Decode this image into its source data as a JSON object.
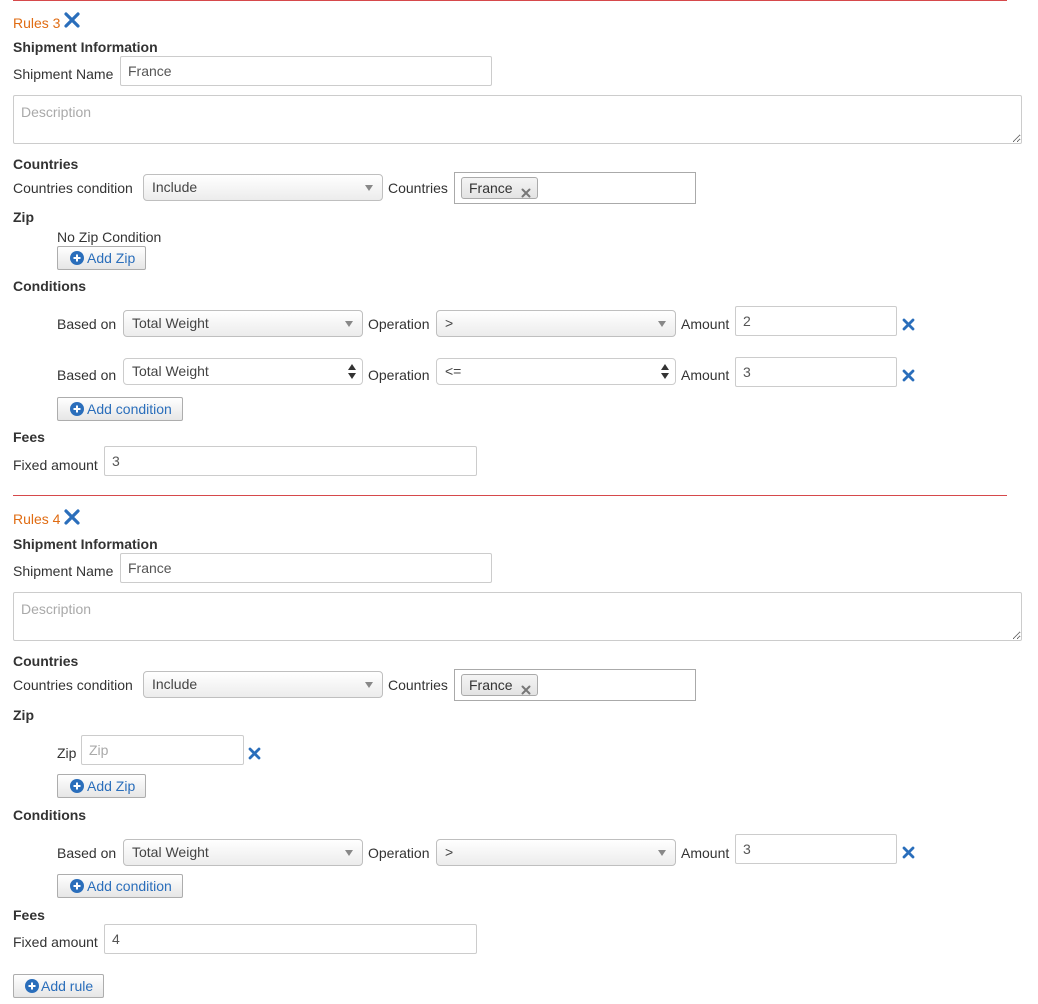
{
  "colors": {
    "rule_title": "#e06c13",
    "divider": "#d6494b",
    "icon_blue": "#2a6ebb",
    "link_blue": "#2a6ebb"
  },
  "icons": {
    "remove": "close-icon",
    "add": "plus-circle-icon",
    "select": "chevron-down-icon"
  },
  "rules": [
    {
      "title": "Rules 3",
      "shipment_heading": "Shipment Information",
      "shipment_name_label": "Shipment Name",
      "shipment_name_value": "France",
      "description_placeholder": "Description",
      "countries_heading": "Countries",
      "countries_condition_label": "Countries condition",
      "countries_condition_value": "Include",
      "countries_label": "Countries",
      "countries_tags": [
        "France"
      ],
      "zip_heading": "Zip",
      "no_zip_text": "No Zip Condition",
      "add_zip_label": "Add Zip",
      "conditions_heading": "Conditions",
      "conditions": [
        {
          "based_on_label": "Based on",
          "based_on_value": "Total Weight",
          "operation_label": "Operation",
          "operation_value": ">",
          "amount_label": "Amount",
          "amount_value": "2"
        },
        {
          "based_on_label": "Based on",
          "based_on_value": "Total Weight",
          "operation_label": "Operation",
          "operation_value": "<=",
          "amount_label": "Amount",
          "amount_value": "3"
        }
      ],
      "add_condition_label": "Add condition",
      "fees_heading": "Fees",
      "fixed_amount_label": "Fixed amount",
      "fixed_amount_value": "3"
    },
    {
      "title": "Rules 4",
      "shipment_heading": "Shipment Information",
      "shipment_name_label": "Shipment Name",
      "shipment_name_value": "France",
      "description_placeholder": "Description",
      "countries_heading": "Countries",
      "countries_condition_label": "Countries condition",
      "countries_condition_value": "Include",
      "countries_label": "Countries",
      "countries_tags": [
        "France"
      ],
      "zip_heading": "Zip",
      "zip_label": "Zip",
      "zip_placeholder": "Zip",
      "add_zip_label": "Add Zip",
      "conditions_heading": "Conditions",
      "conditions": [
        {
          "based_on_label": "Based on",
          "based_on_value": "Total Weight",
          "operation_label": "Operation",
          "operation_value": ">",
          "amount_label": "Amount",
          "amount_value": "3"
        }
      ],
      "add_condition_label": "Add condition",
      "fees_heading": "Fees",
      "fixed_amount_label": "Fixed amount",
      "fixed_amount_value": "4"
    }
  ],
  "add_rule_label": "Add rule"
}
